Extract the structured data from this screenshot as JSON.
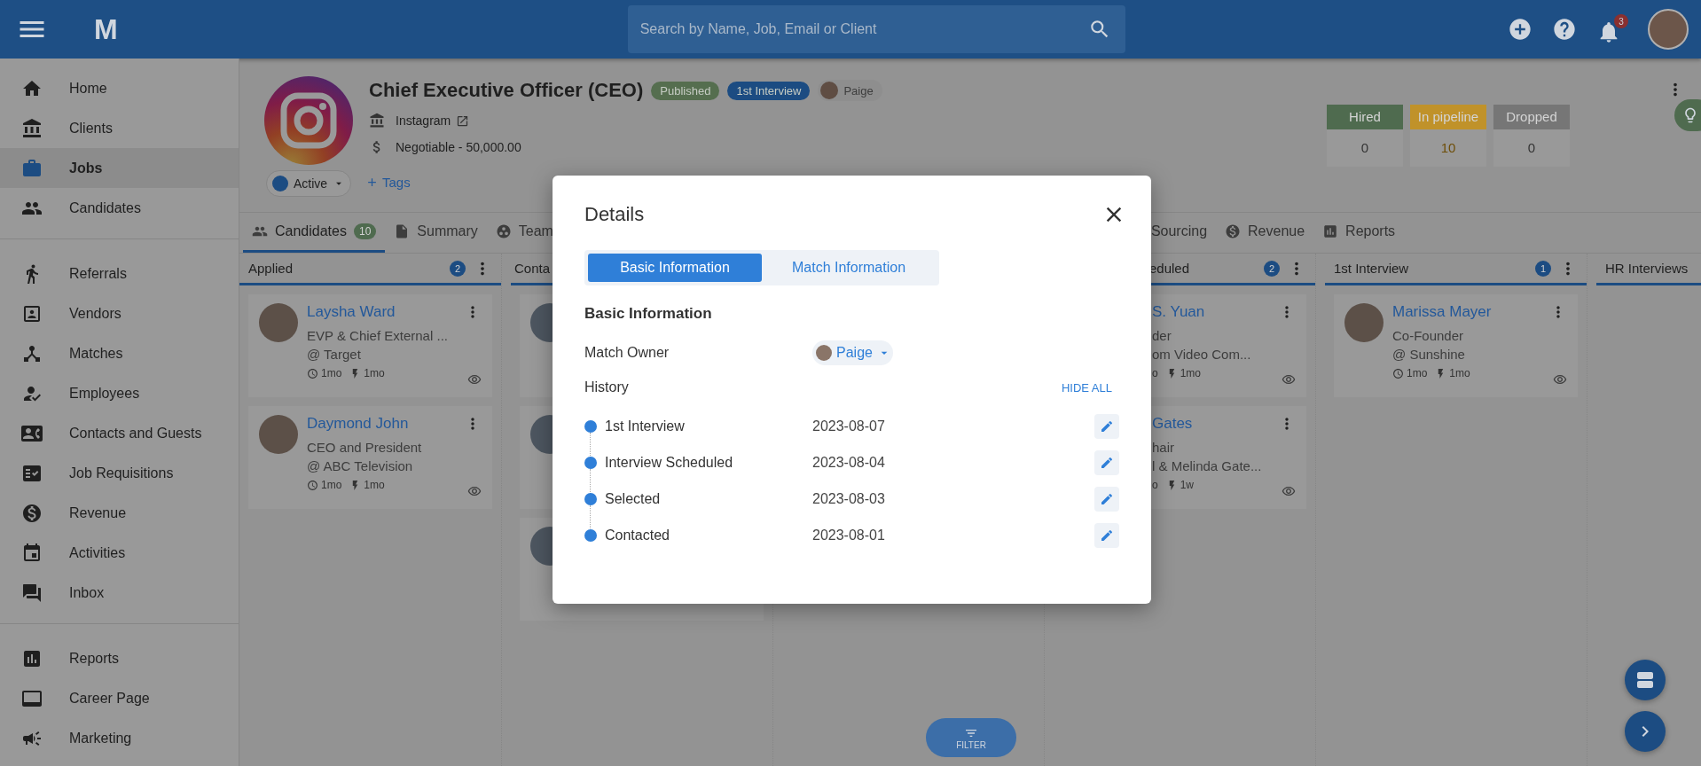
{
  "topbar": {
    "logo": "M",
    "search": {
      "placeholder": "Search by Name, Job, Email or Client"
    },
    "notification_count": "3"
  },
  "sidebar": {
    "groups": [
      [
        {
          "label": "Home",
          "selected": false
        },
        {
          "label": "Clients",
          "selected": false
        },
        {
          "label": "Jobs",
          "selected": true
        },
        {
          "label": "Candidates",
          "selected": false
        }
      ],
      [
        {
          "label": "Referrals",
          "selected": false
        },
        {
          "label": "Vendors",
          "selected": false
        },
        {
          "label": "Matches",
          "selected": false
        },
        {
          "label": "Employees",
          "selected": false
        },
        {
          "label": "Contacts and Guests",
          "selected": false
        },
        {
          "label": "Job Requisitions",
          "selected": false
        },
        {
          "label": "Revenue",
          "selected": false
        },
        {
          "label": "Activities",
          "selected": false
        },
        {
          "label": "Inbox",
          "selected": false
        }
      ],
      [
        {
          "label": "Reports",
          "selected": false
        },
        {
          "label": "Career Page",
          "selected": false
        },
        {
          "label": "Marketing",
          "selected": false
        }
      ]
    ]
  },
  "job": {
    "title": "Chief Executive Officer (CEO)",
    "badges": [
      {
        "label": "Published",
        "color": "#556e4f"
      },
      {
        "label": "1st Interview",
        "color": "#1c4c82"
      }
    ],
    "owner": "Paige",
    "client": "Instagram",
    "salary": "Negotiable - 50,000.00",
    "status": "Active",
    "tags_link": "Tags",
    "stats": [
      {
        "label": "Hired",
        "value": "0",
        "color": "#4f6b4f"
      },
      {
        "label": "In pipeline",
        "value": "10",
        "color": "#c0922a"
      },
      {
        "label": "Dropped",
        "value": "0",
        "color": "#767676"
      }
    ]
  },
  "tabs": [
    {
      "label": "Candidates",
      "count": "10",
      "selected": true
    },
    {
      "label": "Summary",
      "selected": false
    },
    {
      "label": "Team",
      "selected": false
    },
    {
      "label": "Sourcing",
      "selected": false
    },
    {
      "label": "Revenue",
      "selected": false
    },
    {
      "label": "Reports",
      "selected": false
    }
  ],
  "columns": [
    {
      "kind": "open",
      "title": "Applied",
      "count": "2",
      "cards": [
        {
          "kind": "full",
          "name": "Laysha Ward",
          "role": "EVP & Chief External ...",
          "company": "@ Target",
          "last_contact": "1mo",
          "last_activity": "1mo"
        },
        {
          "kind": "full",
          "name": "Daymond John",
          "role": "CEO and President",
          "company": "@ ABC Television",
          "last_contact": "1mo",
          "last_activity": "1mo"
        }
      ]
    },
    {
      "kind": "right_covered",
      "title": "Conta",
      "cards": [
        {
          "kind": "avatar_only"
        },
        {
          "kind": "avatar_only"
        },
        {
          "kind": "avatar_only"
        }
      ]
    },
    {
      "kind": "hidden"
    },
    {
      "kind": "left_covered",
      "title": "eduled",
      "count": "2",
      "cards": [
        {
          "kind": "cut",
          "name": "S. Yuan",
          "role": "der",
          "company": "om Video Com...",
          "last_contact": "o",
          "last_activity": "1mo"
        },
        {
          "kind": "cut",
          "name": "Gates",
          "role": "hair",
          "company": "l & Melinda Gate...",
          "last_contact": "o",
          "last_activity": "1w"
        }
      ]
    },
    {
      "kind": "open",
      "title": "1st Interview",
      "count": "1",
      "cards": [
        {
          "kind": "full",
          "name": "Marissa Mayer",
          "role": "Co-Founder",
          "company": "@ Sunshine",
          "last_contact": "1mo",
          "last_activity": "1mo"
        }
      ]
    },
    {
      "kind": "open",
      "title": "HR Interviews"
    }
  ],
  "filter_button": "FILTER",
  "dialog": {
    "title": "Details",
    "tabs": [
      {
        "label": "Basic Information",
        "selected": true
      },
      {
        "label": "Match Information",
        "selected": false
      }
    ],
    "section_title": "Basic Information",
    "owner_label": "Match Owner",
    "owner": "Paige",
    "history_label": "History",
    "hide_all": "HIDE ALL",
    "history": [
      {
        "stage": "1st Interview",
        "date": "2023-08-07"
      },
      {
        "stage": "Interview Scheduled",
        "date": "2023-08-04"
      },
      {
        "stage": "Selected",
        "date": "2023-08-03"
      },
      {
        "stage": "Contacted",
        "date": "2023-08-01"
      }
    ]
  }
}
